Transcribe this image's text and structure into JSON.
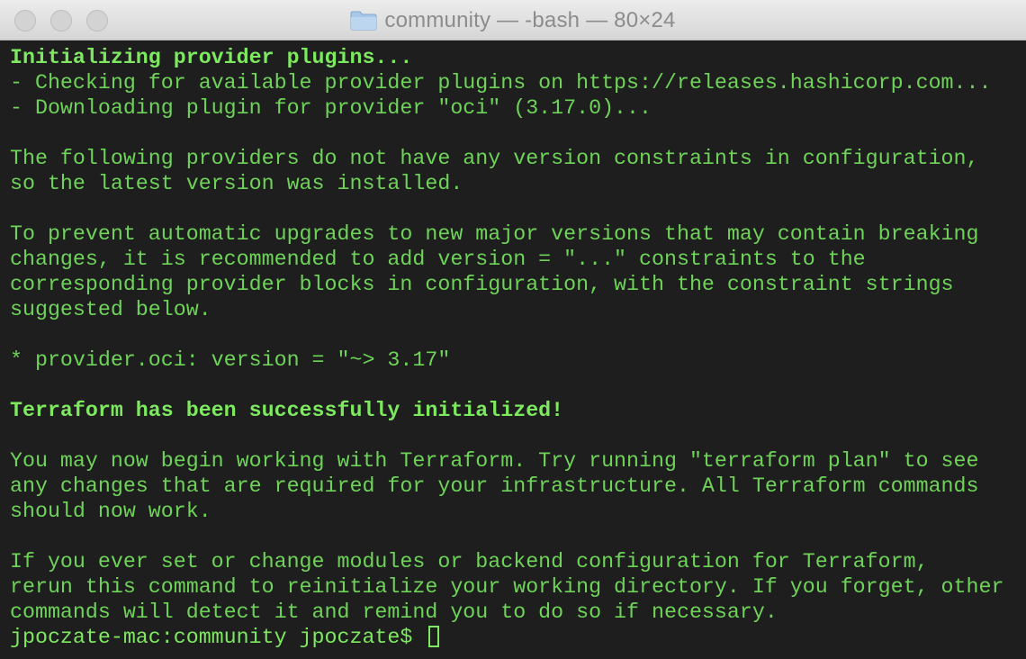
{
  "window": {
    "title": "community — -bash — 80×24",
    "folder_icon": "folder-icon"
  },
  "colors": {
    "terminal_bg": "#1e1e1e",
    "text_green": "#6fd35a",
    "bold_green": "#7ee861"
  },
  "terminal": {
    "lines": [
      "Initializing provider plugins...",
      "- Checking for available provider plugins on https://releases.hashicorp.com...",
      "- Downloading plugin for provider \"oci\" (3.17.0)...",
      "",
      "The following providers do not have any version constraints in configuration,",
      "so the latest version was installed.",
      "",
      "To prevent automatic upgrades to new major versions that may contain breaking",
      "changes, it is recommended to add version = \"...\" constraints to the",
      "corresponding provider blocks in configuration, with the constraint strings",
      "suggested below.",
      "",
      "* provider.oci: version = \"~> 3.17\"",
      "",
      "Terraform has been successfully initialized!",
      "",
      "You may now begin working with Terraform. Try running \"terraform plan\" to see",
      "any changes that are required for your infrastructure. All Terraform commands",
      "should now work.",
      "",
      "If you ever set or change modules or backend configuration for Terraform,",
      "rerun this command to reinitialize your working directory. If you forget, other",
      "commands will detect it and remind you to do so if necessary."
    ],
    "prompt": "jpoczate-mac:community jpoczate$ "
  }
}
